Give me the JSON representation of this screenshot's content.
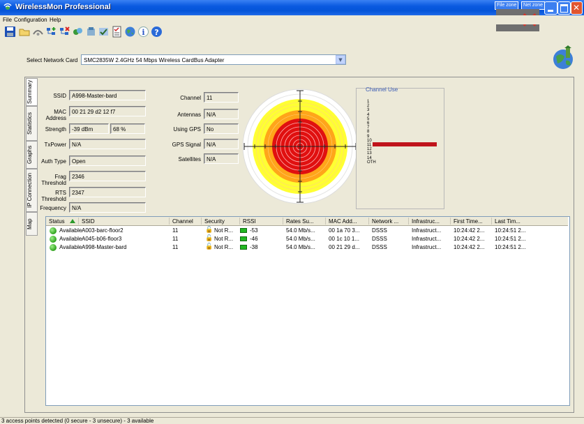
{
  "window": {
    "title": "WirelessMon Professional"
  },
  "zone_buttons": {
    "file_zone": "File zone",
    "net_zone": "Net zone"
  },
  "menu": [
    "File",
    "Configuration",
    "Help"
  ],
  "toolbar_icons": [
    "save-icon",
    "open-folder-icon",
    "access-point-icon",
    "network-add-icon",
    "network-remove-icon",
    "connect-icon",
    "disconnect-icon",
    "log-icon",
    "report-icon",
    "globe-icon",
    "info-icon",
    "help-icon"
  ],
  "network_card": {
    "label": "Select Network Card",
    "value": "SMC2835W 2.4GHz 54 Mbps Wireless CardBus Adapter"
  },
  "tabs": [
    "Summary",
    "Statistics",
    "Graphs",
    "IP Connection",
    "Map"
  ],
  "summary": {
    "ssid_label": "SSID",
    "ssid": "A998-Master-bard",
    "mac_label": "MAC Address",
    "mac": "00 21 29 d2 12 f7",
    "strength_label": "Strength",
    "strength_dbm": "-39 dBm",
    "strength_pct": "68 %",
    "txpower_label": "TxPower",
    "txpower": "N/A",
    "auth_label": "Auth Type",
    "auth": "Open",
    "frag_label": "Frag Threshold",
    "frag": "2346",
    "rts_label": "RTS Threshold",
    "rts": "2347",
    "freq_label": "Frequency",
    "freq": "N/A",
    "channel_label": "Channel",
    "channel": "11",
    "antennas_label": "Antennas",
    "antennas": "N/A",
    "gps_label": "Using GPS",
    "gps": "No",
    "gps_signal_label": "GPS Signal",
    "gps_signal": "N/A",
    "satellites_label": "Satellites",
    "satellites": "N/A"
  },
  "channel_use": {
    "title": "Channel Use",
    "channels": [
      "1",
      "2",
      "3",
      "4",
      "5",
      "6",
      "7",
      "8",
      "9",
      "10",
      "11",
      "12",
      "13",
      "14",
      "OTH"
    ],
    "active_channel": "11",
    "active_fraction": 0.85,
    "bar_color": "#c0141c"
  },
  "list": {
    "columns": [
      "Status",
      "SSID",
      "Channel",
      "Security",
      "RSSI",
      "Rates Su...",
      "MAC Add...",
      "Network ...",
      "Infrastruc...",
      "First Time...",
      "Last Tim..."
    ],
    "rows": [
      {
        "status": "Available",
        "ssid": "A003-barc-floor2",
        "channel": "11",
        "security": "Not R...",
        "rssi": "-53",
        "rates": "54.0 Mb/s...",
        "mac": "00 1a 70 3...",
        "network": "DSSS",
        "infra": "Infrastruct...",
        "first": "10:24:42 2...",
        "last": "10:24:51 2..."
      },
      {
        "status": "Available",
        "ssid": "A045-b06-floor3",
        "channel": "11",
        "security": "Not R...",
        "rssi": "-46",
        "rates": "54.0 Mb/s...",
        "mac": "00 1c 10 1...",
        "network": "DSSS",
        "infra": "Infrastruct...",
        "first": "10:24:42 2...",
        "last": "10:24:51 2..."
      },
      {
        "status": "Available",
        "ssid": "A998-Master-bard",
        "channel": "11",
        "security": "Not R...",
        "rssi": "-38",
        "rates": "54.0 Mb/s...",
        "mac": "00 21 29 d...",
        "network": "DSSS",
        "infra": "Infrastruct...",
        "first": "10:24:42 2...",
        "last": "10:24:51 2..."
      }
    ]
  },
  "status_bar": {
    "text": "3 access points detected (0 secure - 3 unsecure) - 3 available"
  },
  "colors": {
    "titlebar": "#0454d8",
    "radar_outer": "#ffff00",
    "radar_mid": "#ffa500",
    "radar_inner": "#d40000",
    "available": "#2ea11c"
  }
}
